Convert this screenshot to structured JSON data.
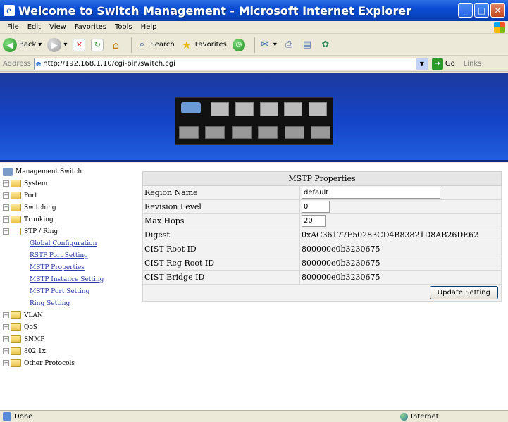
{
  "window": {
    "title": "Welcome to Switch Management - Microsoft Internet Explorer",
    "buttons": {
      "minimize": "_",
      "maximize": "□",
      "close": "✕"
    }
  },
  "menu": [
    "File",
    "Edit",
    "View",
    "Favorites",
    "Tools",
    "Help"
  ],
  "toolbar": {
    "back": "Back",
    "search": "Search",
    "favorites": "Favorites"
  },
  "address": {
    "label": "Address",
    "url": "http://192.168.1.10/cgi-bin/switch.cgi",
    "go": "Go",
    "links": "Links"
  },
  "tree": {
    "root": "Management Switch",
    "items": [
      {
        "label": "System",
        "expanded": false
      },
      {
        "label": "Port",
        "expanded": false
      },
      {
        "label": "Switching",
        "expanded": false
      },
      {
        "label": "Trunking",
        "expanded": false
      },
      {
        "label": "STP / Ring",
        "expanded": true
      }
    ],
    "stp_children": [
      "Global Configuration",
      "RSTP Port Setting",
      "MSTP Properties",
      "MSTP Instance Setting",
      "MSTP Port Setting",
      "Ring Setting"
    ],
    "after_items": [
      {
        "label": "VLAN"
      },
      {
        "label": "QoS"
      },
      {
        "label": "SNMP"
      },
      {
        "label": "802.1x"
      },
      {
        "label": "Other Protocols"
      }
    ]
  },
  "mstp": {
    "heading": "MSTP Properties",
    "rows": {
      "region_name": {
        "label": "Region Name",
        "value": "default"
      },
      "revision_level": {
        "label": "Revision Level",
        "value": "0"
      },
      "max_hops": {
        "label": "Max Hops",
        "value": "20"
      },
      "digest": {
        "label": "Digest",
        "value": "0xAC36177F50283CD4B83821D8AB26DE62"
      },
      "cist_root_id": {
        "label": "CIST Root ID",
        "value": "800000e0b3230675"
      },
      "cist_reg_root_id": {
        "label": "CIST Reg Root ID",
        "value": "800000e0b3230675"
      },
      "cist_bridge_id": {
        "label": "CIST Bridge ID",
        "value": "800000e0b3230675"
      }
    },
    "update_button": "Update Setting"
  },
  "status": {
    "text": "Done",
    "zone": "Internet"
  }
}
